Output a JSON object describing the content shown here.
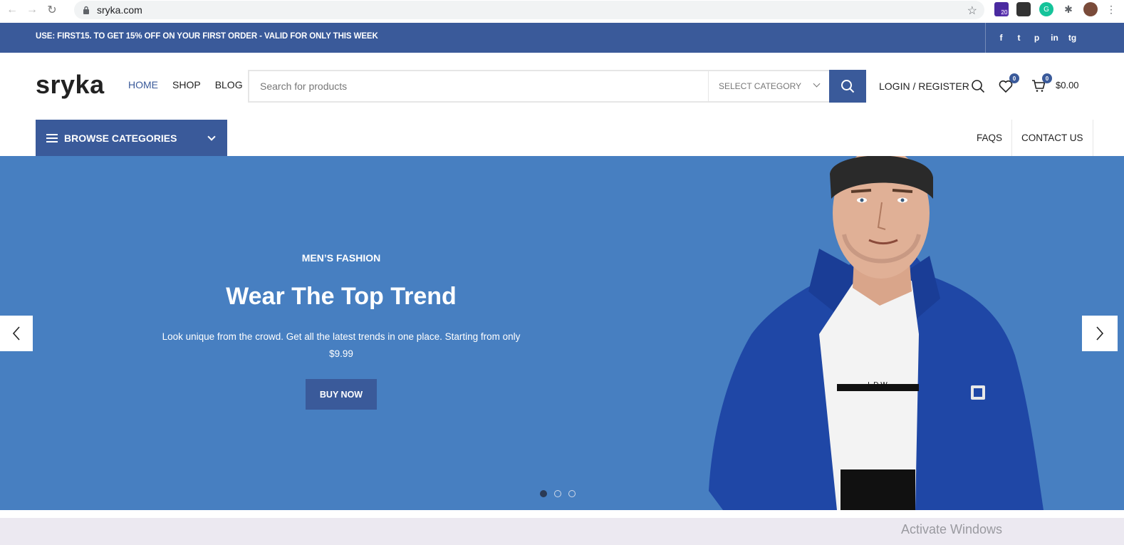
{
  "browser": {
    "url": "sryka.com",
    "extension_badge": "20"
  },
  "promo": {
    "text": "USE: FIRST15. TO GET 15% OFF ON YOUR FIRST ORDER - VALID FOR ONLY THIS WEEK",
    "socials": [
      "f",
      "t",
      "p",
      "in",
      "tg"
    ]
  },
  "header": {
    "logo": "sryka",
    "nav": [
      {
        "label": "HOME",
        "active": true
      },
      {
        "label": "SHOP",
        "active": false
      },
      {
        "label": "BLOG",
        "active": false
      }
    ],
    "search_placeholder": "Search for products",
    "select_category": "SELECT CATEGORY",
    "login": "LOGIN / REGISTER",
    "wishlist_count": "0",
    "cart_count": "0",
    "cart_total": "$0.00"
  },
  "subnav": {
    "browse": "BROWSE CATEGORIES",
    "links": [
      "FAQS",
      "CONTACT US"
    ]
  },
  "hero": {
    "subtitle": "MEN’S FASHION",
    "title": "Wear The Top Trend",
    "description": "Look unique from the crowd. Get all the latest trends in one place. Starting from only $9.99",
    "button": "BUY NOW",
    "slide_count": 3,
    "active_slide": 1,
    "shirt_text": "L D W"
  },
  "os": {
    "watermark": "Activate Windows"
  },
  "colors": {
    "brand": "#3a5a9a",
    "hero_bg": "#477fc1",
    "jacket": "#1f47a6"
  }
}
